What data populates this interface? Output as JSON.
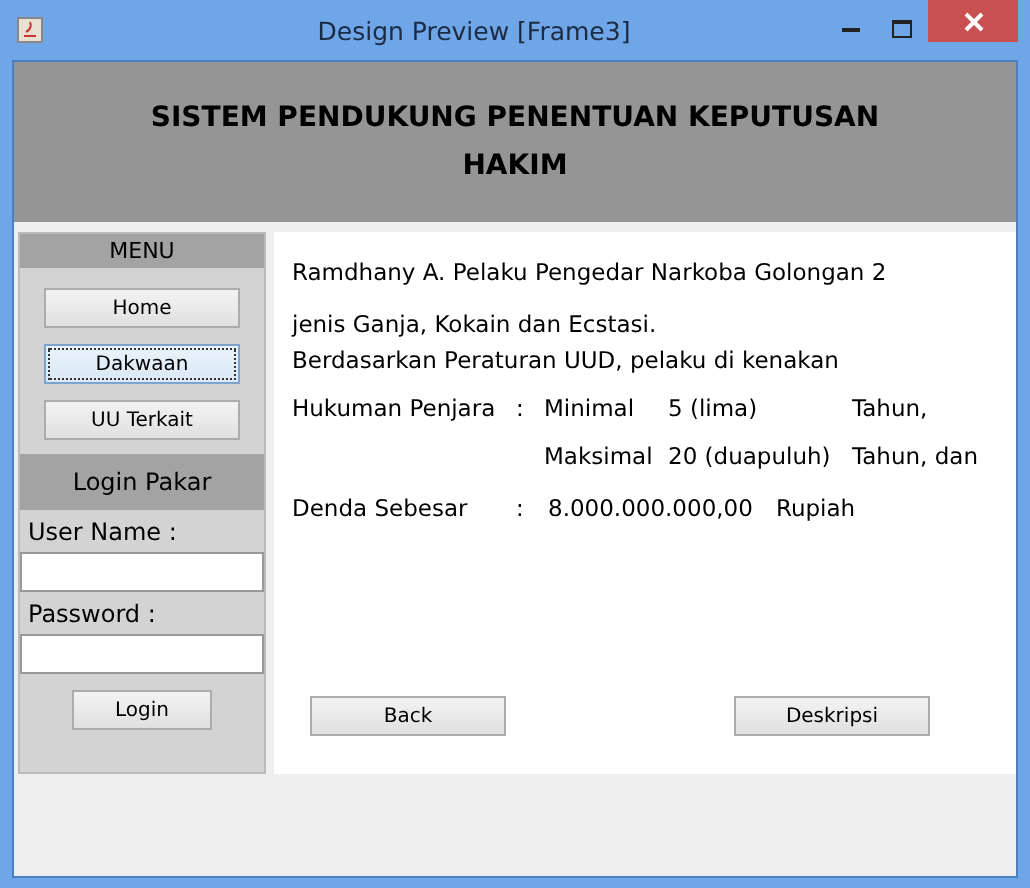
{
  "window": {
    "title": "Design Preview [Frame3]"
  },
  "header": {
    "title": "SISTEM PENDUKUNG PENENTUAN KEPUTUSAN HAKIM"
  },
  "sidebar": {
    "menu_title": "MENU",
    "menu_buttons": [
      {
        "label": "Home",
        "focused": false
      },
      {
        "label": "Dakwaan",
        "focused": true
      },
      {
        "label": "UU Terkait",
        "focused": false
      }
    ],
    "login_title": "Login Pakar",
    "username_label": "User Name :",
    "password_label": "Password :",
    "login_button": "Login"
  },
  "content": {
    "lines": [
      "Ramdhany A. Pelaku Pengedar Narkoba Golongan 2",
      "jenis Ganja, Kokain dan Ecstasi.",
      "Berdasarkan Peraturan UUD, pelaku di kenakan"
    ],
    "sentence_rows": [
      {
        "label": "Hukuman Penjara",
        "colon": ":",
        "kind": "Minimal",
        "amount": "5 (lima)",
        "unit": "Tahun,"
      },
      {
        "label": "",
        "colon": "",
        "kind": "Maksimal",
        "amount": "20 (duapuluh)",
        "unit": "Tahun, dan"
      }
    ],
    "fine": {
      "label": "Denda Sebesar",
      "colon": ":",
      "amount": "8.000.000.000,00",
      "unit": "Rupiah"
    },
    "buttons": [
      "Back",
      "Deskripsi"
    ]
  }
}
